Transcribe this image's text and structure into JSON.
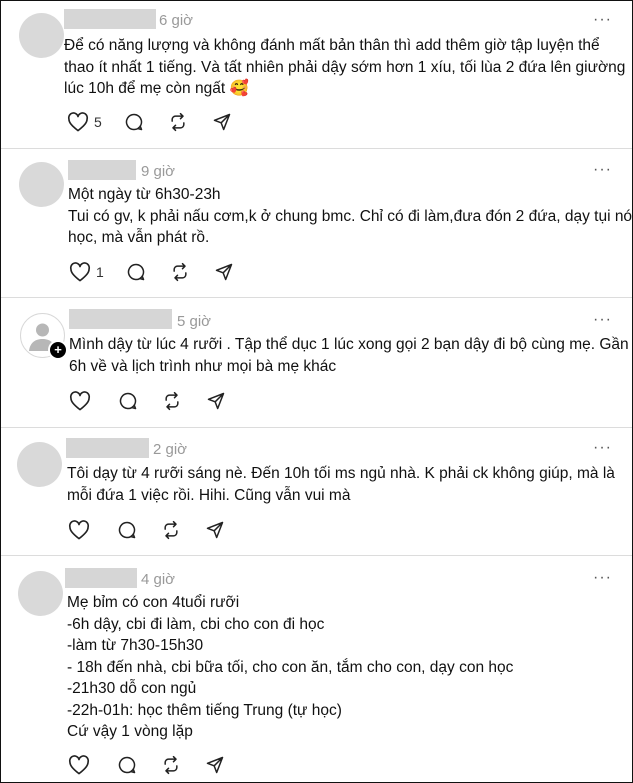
{
  "posts": [
    {
      "time": "6 giờ",
      "lines": [
        "Để có năng lượng và không đánh mất bản thân thì add thêm giờ tập luyện thể",
        "thao ít nhất 1 tiếng. Và tất nhiên phải dậy sớm hơn 1 xíu, tối lùa 2 đứa lên giường",
        "lúc 10h để mẹ còn ngất 🥰"
      ],
      "likes": "5"
    },
    {
      "time": "9 giờ",
      "lines": [
        "Một ngày từ 6h30-23h",
        "Tui có gv, k phải nấu cơm,k ở chung bmc. Chỉ có đi làm,đưa đón 2 đứa, dạy tụi nó",
        "học, mà vẫn phát rồ."
      ],
      "likes": "1"
    },
    {
      "time": "5 giờ",
      "lines": [
        "Mình dậy từ lúc 4 rưỡi . Tập thể dục 1 lúc xong gọi 2 bạn dậy đi bộ cùng mẹ. Gần",
        "6h về và lịch trình như mọi bà mẹ khác"
      ],
      "likes": ""
    },
    {
      "time": "2 giờ",
      "lines": [
        "Tôi dạy từ 4 rưỡi sáng nè. Đến 10h tối ms ngủ nhà. K phải ck không giúp, mà là",
        "mỗi đứa 1 việc rồi. Hihi. Cũng vẫn vui mà"
      ],
      "likes": ""
    },
    {
      "time": "4 giờ",
      "lines": [
        "Mẹ bỉm có con 4tuổi rưỡi",
        "-6h dậy, cbi đi làm, cbi cho con đi học",
        "-làm từ 7h30-15h30",
        "- 18h đến nhà, cbi bữa tối, cho con ăn, tắm cho con, dạy con học",
        "-21h30 dỗ con ngủ",
        "-22h-01h: học thêm tiếng Trung (tự học)",
        "Cứ vậy 1 vòng lặp"
      ],
      "likes": ""
    }
  ],
  "more_glyph": "···",
  "icons": {
    "avatar_badge": "+"
  },
  "colors": {
    "text": "#111111",
    "muted": "#999999",
    "placeholder": "#d9d9d9",
    "divider": "#dcdcdc"
  }
}
